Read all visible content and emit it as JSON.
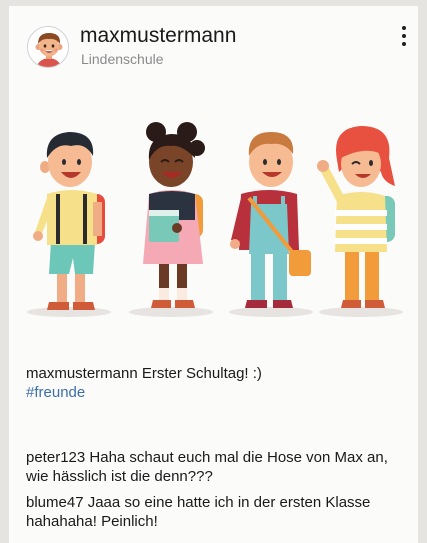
{
  "post": {
    "username": "maxmustermann",
    "school": "Lindenschule",
    "caption_user": "maxmustermann",
    "caption_text": "Erster Schultag! :)",
    "hashtag": "#freunde"
  },
  "comments": [
    {
      "user": "peter123",
      "text": "Haha schaut euch mal die Hose von Max an, wie hässlich ist die denn???"
    },
    {
      "user": "blume47",
      "text": "Jaaa so eine hatte ich in der ersten Klasse hahahaha! Peinlich!"
    }
  ],
  "icons": {
    "avatar": "boy-avatar-icon",
    "menu": "more-vertical-icon"
  },
  "colors": {
    "page_background": "#e6e4e1",
    "card_background": "#fbfbfa",
    "hashtag": "#3e6fad",
    "secondary_text": "#8a8a8a"
  }
}
